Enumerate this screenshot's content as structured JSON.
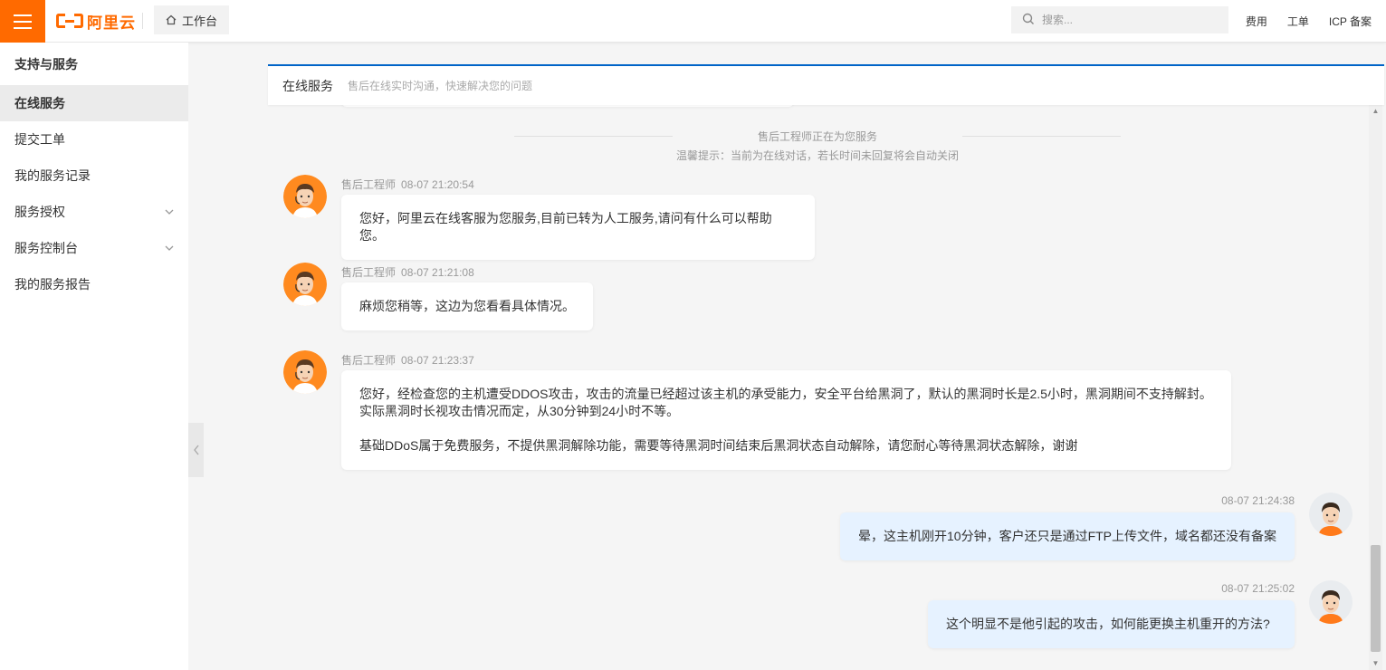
{
  "header": {
    "logo_text": "阿里云",
    "workbench_label": "工作台",
    "search_placeholder": "搜索...",
    "links": [
      "费用",
      "工单",
      "ICP 备案"
    ]
  },
  "sidebar": {
    "title": "支持与服务",
    "items": [
      {
        "label": "在线服务",
        "active": true,
        "expandable": false
      },
      {
        "label": "提交工单",
        "active": false,
        "expandable": false
      },
      {
        "label": "我的服务记录",
        "active": false,
        "expandable": false
      },
      {
        "label": "服务授权",
        "active": false,
        "expandable": true
      },
      {
        "label": "服务控制台",
        "active": false,
        "expandable": true
      },
      {
        "label": "我的服务报告",
        "active": false,
        "expandable": false
      }
    ]
  },
  "chat": {
    "title": "在线服务",
    "subtitle": "售后在线实时沟通，快速解决您的问题",
    "system_notice": "售后工程师正在为您服务",
    "system_tip": "温馨提示：当前为在线对话，若长时间未回复将会自动关闭",
    "messages": [
      {
        "sender": "售后工程师",
        "time": "08-07 21:20:54",
        "text": "您好，阿里云在线客服为您服务,目前已转为人工服务,请问有什么可以帮助您。",
        "mine": false
      },
      {
        "sender": "售后工程师",
        "time": "08-07 21:21:08",
        "text": "麻烦您稍等，这边为您看看具体情况。",
        "mine": false
      },
      {
        "sender": "售后工程师",
        "time": "08-07 21:23:37",
        "text": "您好，经检查您的主机遭受DDOS攻击，攻击的流量已经超过该主机的承受能力，安全平台给黑洞了，默认的黑洞时长是2.5小时，黑洞期间不支持解封。\n实际黑洞时长视攻击情况而定，从30分钟到24小时不等。\n\n基础DDoS属于免费服务，不提供黑洞解除功能，需要等待黑洞时间结束后黑洞状态自动解除，请您耐心等待黑洞状态解除，谢谢",
        "mine": false
      },
      {
        "sender": "",
        "time": "08-07 21:24:38",
        "text": "晕，这主机刚开10分钟，客户还只是通过FTP上传文件，域名都还没有备案",
        "mine": true
      },
      {
        "sender": "",
        "time": "08-07 21:25:02",
        "text": "这个明显不是他引起的攻击，如何能更换主机重开的方法?",
        "mine": true
      }
    ]
  },
  "colors": {
    "accent": "#ff6a00",
    "header_border": "#0064c8",
    "my_bubble": "#e6f2ff",
    "sidebar_active": "#ebebeb"
  },
  "icons": {
    "menu": "hamburger-icon",
    "home": "home-icon",
    "search": "search-icon",
    "chevron": "chevron-down-icon",
    "collapse": "chevron-left-icon"
  }
}
